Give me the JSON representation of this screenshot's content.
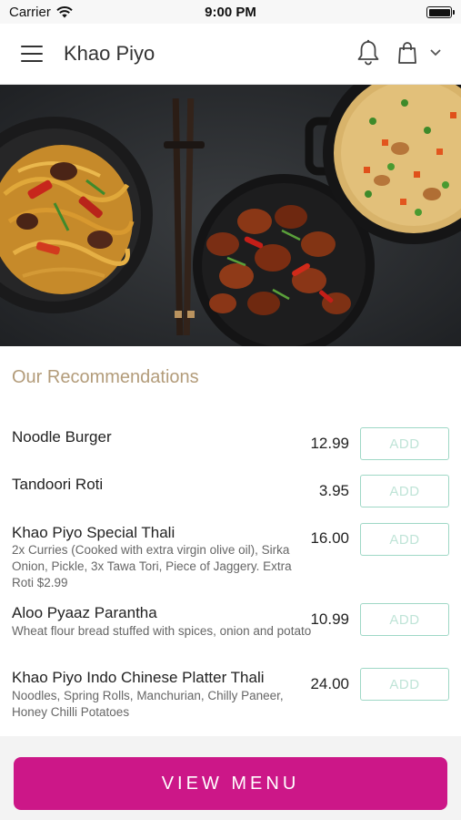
{
  "status_bar": {
    "carrier": "Carrier",
    "time": "9:00 PM"
  },
  "header": {
    "title": "Khao Piyo"
  },
  "icons": [
    "menu-icon",
    "wifi-icon",
    "battery-icon",
    "bell-icon",
    "shopping-bag-icon",
    "chevron-down-icon"
  ],
  "section": {
    "title": "Our Recommendations"
  },
  "items": [
    {
      "name": "Noodle Burger",
      "description": "",
      "price": "12.99",
      "add_label": "ADD"
    },
    {
      "name": "Tandoori Roti",
      "description": "",
      "price": "3.95",
      "add_label": "ADD"
    },
    {
      "name": "Khao Piyo Special Thali",
      "description": "2x Curries (Cooked with extra virgin olive oil), Sirka Onion, Pickle, 3x Tawa Tori, Piece of Jaggery. Extra Roti $2.99",
      "price": "16.00",
      "add_label": "ADD"
    },
    {
      "name": "Aloo Pyaaz Parantha",
      "description": "Wheat flour bread stuffed with spices, onion and potato",
      "price": "10.99",
      "add_label": "ADD"
    },
    {
      "name": "Khao Piyo Indo Chinese Platter Thali",
      "description": "Noodles, Spring Rolls, Manchurian, Chilly Paneer, Honey Chilli Potatoes",
      "price": "24.00",
      "add_label": "ADD"
    }
  ],
  "footer": {
    "view_menu_label": "VIEW MENU"
  },
  "colors": {
    "accent": "#cc1788",
    "section_title": "#b39c7a",
    "add_border": "#9fd8c6",
    "add_text": "#bfe4d7"
  }
}
